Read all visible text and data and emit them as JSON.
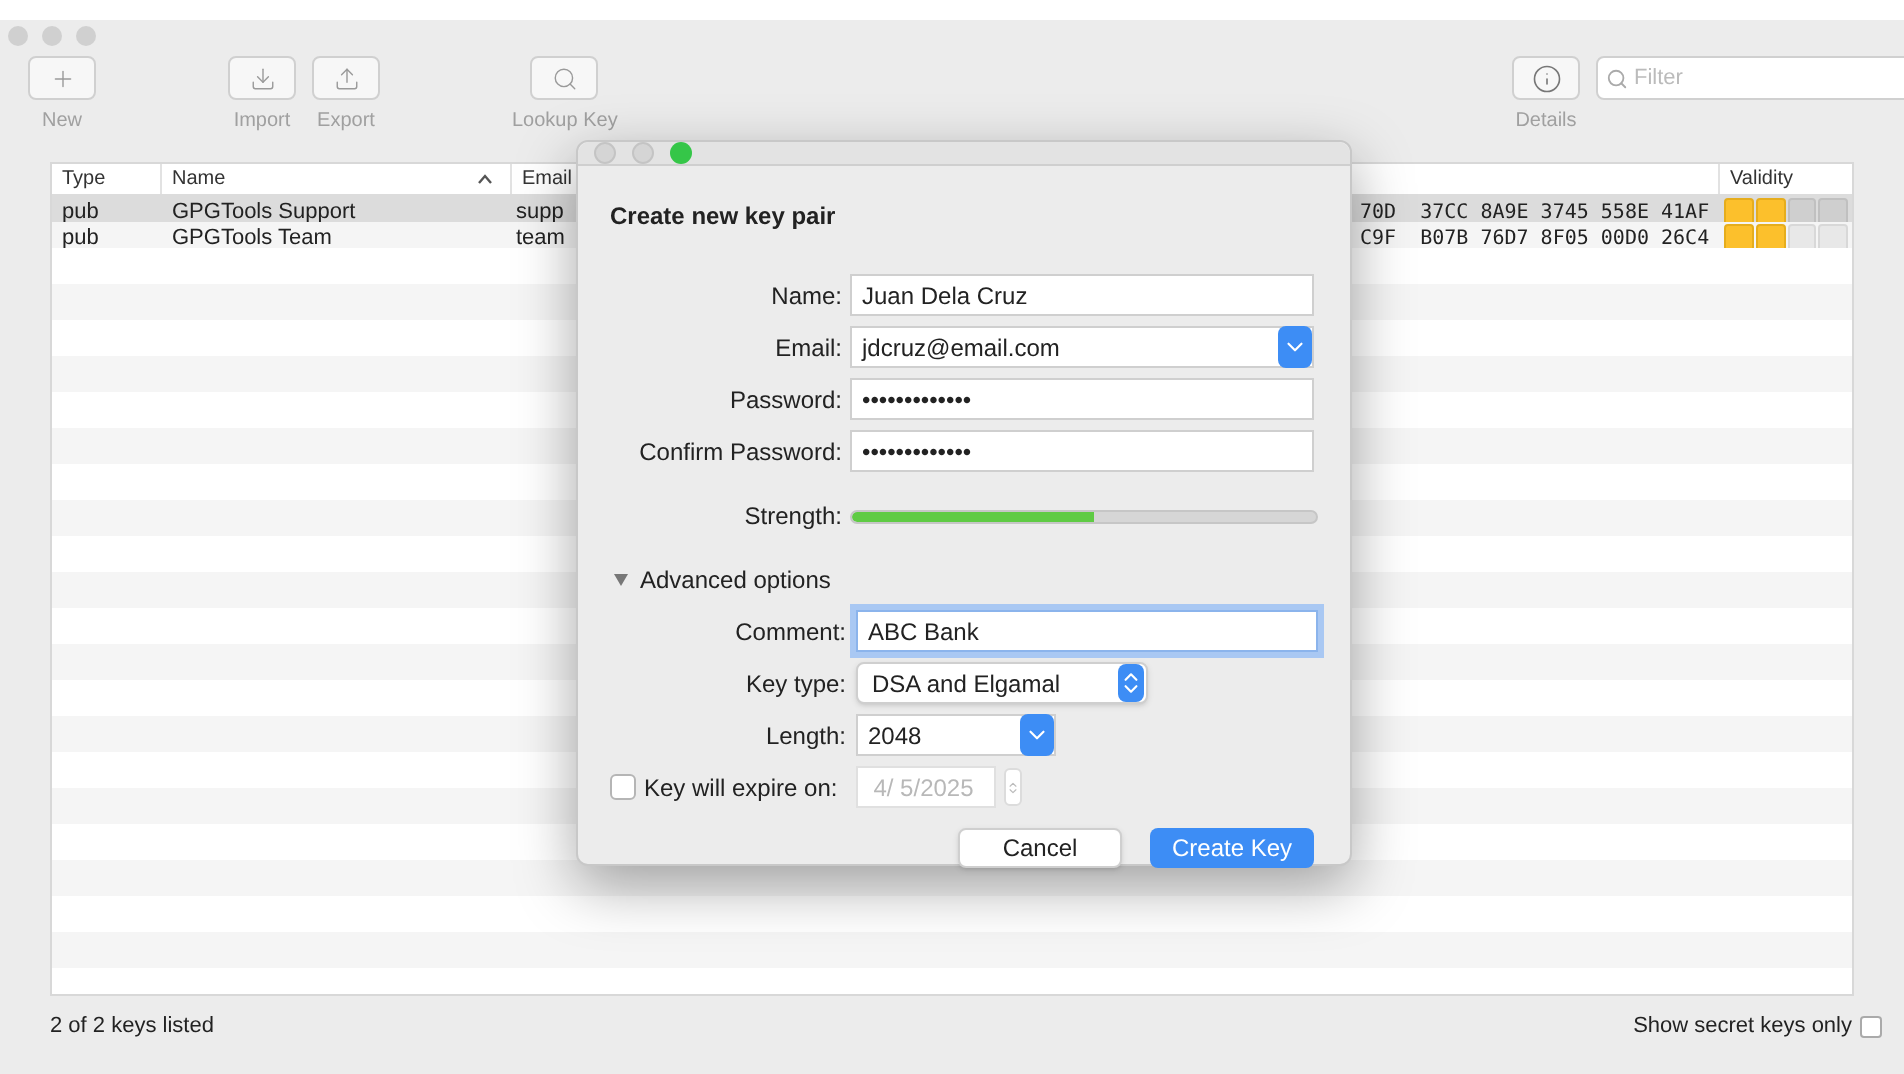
{
  "toolbar": {
    "left": [
      {
        "label": "New",
        "kind": "plus"
      },
      {
        "label": "Import",
        "kind": "import"
      },
      {
        "label": "Export",
        "kind": "export"
      },
      {
        "label": "Lookup Key",
        "kind": "search"
      }
    ],
    "right": [
      {
        "label": "Details",
        "kind": "info"
      }
    ],
    "filter": {
      "placeholder": "Filter"
    }
  },
  "table": {
    "columns": [
      {
        "label": "Type",
        "sorted": false
      },
      {
        "label": "Name",
        "sorted": true
      },
      {
        "label": "Email",
        "sorted": false
      },
      {
        "label": "Validity",
        "sorted": false
      }
    ],
    "rows": [
      {
        "type": "pub",
        "name": "GPGTools Support",
        "email": "supp",
        "fingerprint": "70D  37CC 8A9E 3745 558E 41AF",
        "level": 0.5,
        "selected": true
      },
      {
        "type": "pub",
        "name": "GPGTools Team",
        "email": "team",
        "fingerprint": "C9F  B07B 76D7 8F05 00D0 26C4",
        "level": 0.5,
        "selected": false
      }
    ]
  },
  "dialog": {
    "title": "Create new key pair",
    "fields": [
      {
        "label": "Name:",
        "value": "Juan Dela Cruz",
        "kind": "text"
      },
      {
        "label": "Email:",
        "value": "jdcruz@email.com",
        "kind": "combo"
      },
      {
        "label": "Password:",
        "value": "•••••••••••••",
        "kind": "text"
      },
      {
        "label": "Confirm Password:",
        "value": "•••••••••••••",
        "kind": "text"
      }
    ],
    "strength": {
      "label": "Strength:",
      "level": 0.52
    },
    "advanced": {
      "label": "Advanced options",
      "expanded": true,
      "fields": [
        {
          "label": "Comment:",
          "value": "ABC Bank",
          "kind": "focused"
        },
        {
          "label": "Key type:",
          "value": "DSA and Elgamal",
          "kind": "popup"
        },
        {
          "label": "Length:",
          "value": "2048",
          "kind": "combo"
        }
      ],
      "expiry": {
        "label": "Key will expire on:",
        "checked": false,
        "value": "4/ 5/2025"
      }
    },
    "buttons": [
      {
        "label": "Cancel",
        "default": false
      },
      {
        "label": "Create Key",
        "default": true
      }
    ]
  },
  "footer": {
    "count": "2 of 2 keys listed",
    "secret_only": {
      "label": "Show secret keys only",
      "checked": false
    }
  }
}
